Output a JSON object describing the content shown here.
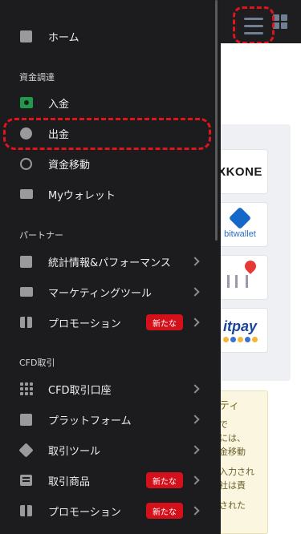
{
  "drawer": {
    "sections": {
      "funds": "資金調達",
      "partner": "パートナー",
      "cfd": "CFD取引"
    },
    "items": [
      {
        "label": "ホーム",
        "icon": "chart-bar-icon"
      },
      {
        "label": "入金",
        "icon": "deposit-icon"
      },
      {
        "label": "出金",
        "icon": "withdraw-icon"
      },
      {
        "label": "資金移動",
        "icon": "transfer-icon"
      },
      {
        "label": "Myウォレット",
        "icon": "wallet-icon"
      },
      {
        "label": "統計情報&パフォーマンス",
        "icon": "stats-icon"
      },
      {
        "label": "マーケティングツール",
        "icon": "marketing-icon"
      },
      {
        "label": "プロモーション",
        "icon": "gift-icon",
        "badge": "新たな"
      },
      {
        "label": "CFD取引口座",
        "icon": "accounts-grid-icon"
      },
      {
        "label": "プラットフォーム",
        "icon": "platform-icon"
      },
      {
        "label": "取引ツール",
        "icon": "tools-tag-icon"
      },
      {
        "label": "取引商品",
        "icon": "products-list-icon",
        "badge": "新たな"
      },
      {
        "label": "プロモーション",
        "icon": "gift-icon",
        "badge": "新たな"
      }
    ]
  },
  "background": {
    "logos": [
      "XKONE",
      "bitwallet",
      "itpay"
    ],
    "notice_lines": [
      "ティ",
      "で",
      "には、",
      "金移動",
      "入力され",
      "社は責",
      "された"
    ]
  },
  "colors": {
    "accent_red": "#e0141b",
    "drawer_bg": "#1c1c1e",
    "badge_bg": "#d4111a",
    "deposit_green": "#1f9a4a"
  }
}
